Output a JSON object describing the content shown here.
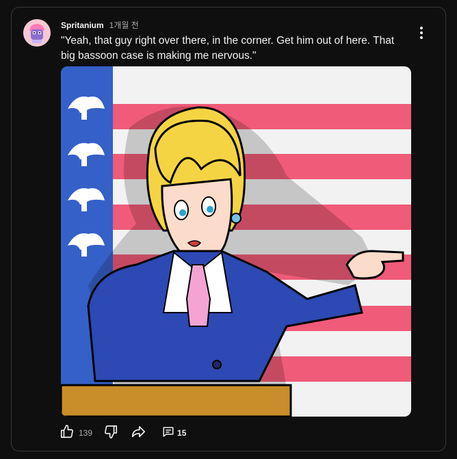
{
  "post": {
    "author": "Spritanium",
    "time": "1개월 전",
    "text": "\"Yeah, that guy right over there, in the corner. Get him out of here. That big bassoon case is making me nervous.\"",
    "image_icon": "cartoon-woman-at-podium-pointing",
    "likes": "139",
    "comments": "15"
  },
  "icons": {
    "menu": "more-vert-icon",
    "like": "thumbs-up-icon",
    "dislike": "thumbs-down-icon",
    "share": "share-icon",
    "comment": "comment-icon"
  },
  "colors": {
    "background": "#0f0f0f",
    "border": "#3a3a3a",
    "text": "#f1f1f1",
    "muted": "#aaaaaa"
  }
}
